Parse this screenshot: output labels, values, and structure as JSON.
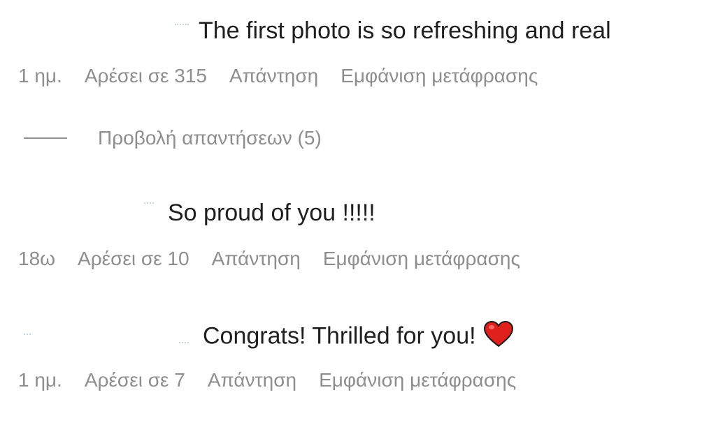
{
  "comments": [
    {
      "text": "The first photo is so refreshing and real",
      "time": "1 ημ.",
      "likes": "Αρέσει σε 315",
      "reply": "Απάντηση",
      "translate": "Εμφάνιση μετάφρασης",
      "view_replies": "Προβολή απαντήσεων (5)"
    },
    {
      "text": "So proud of you !!!!!",
      "time": "18ω",
      "likes": "Αρέσει σε 10",
      "reply": "Απάντηση",
      "translate": "Εμφάνιση μετάφρασης"
    },
    {
      "text": "Congrats! Thrilled for you!",
      "emoji": "heart-icon",
      "time": "1 ημ.",
      "likes": "Αρέσει σε 7",
      "reply": "Απάντηση",
      "translate": "Εμφάνιση μετάφρασης"
    }
  ],
  "colors": {
    "text": "#1f1f1f",
    "meta": "#8e8e8e",
    "heart": "#e0201c"
  }
}
